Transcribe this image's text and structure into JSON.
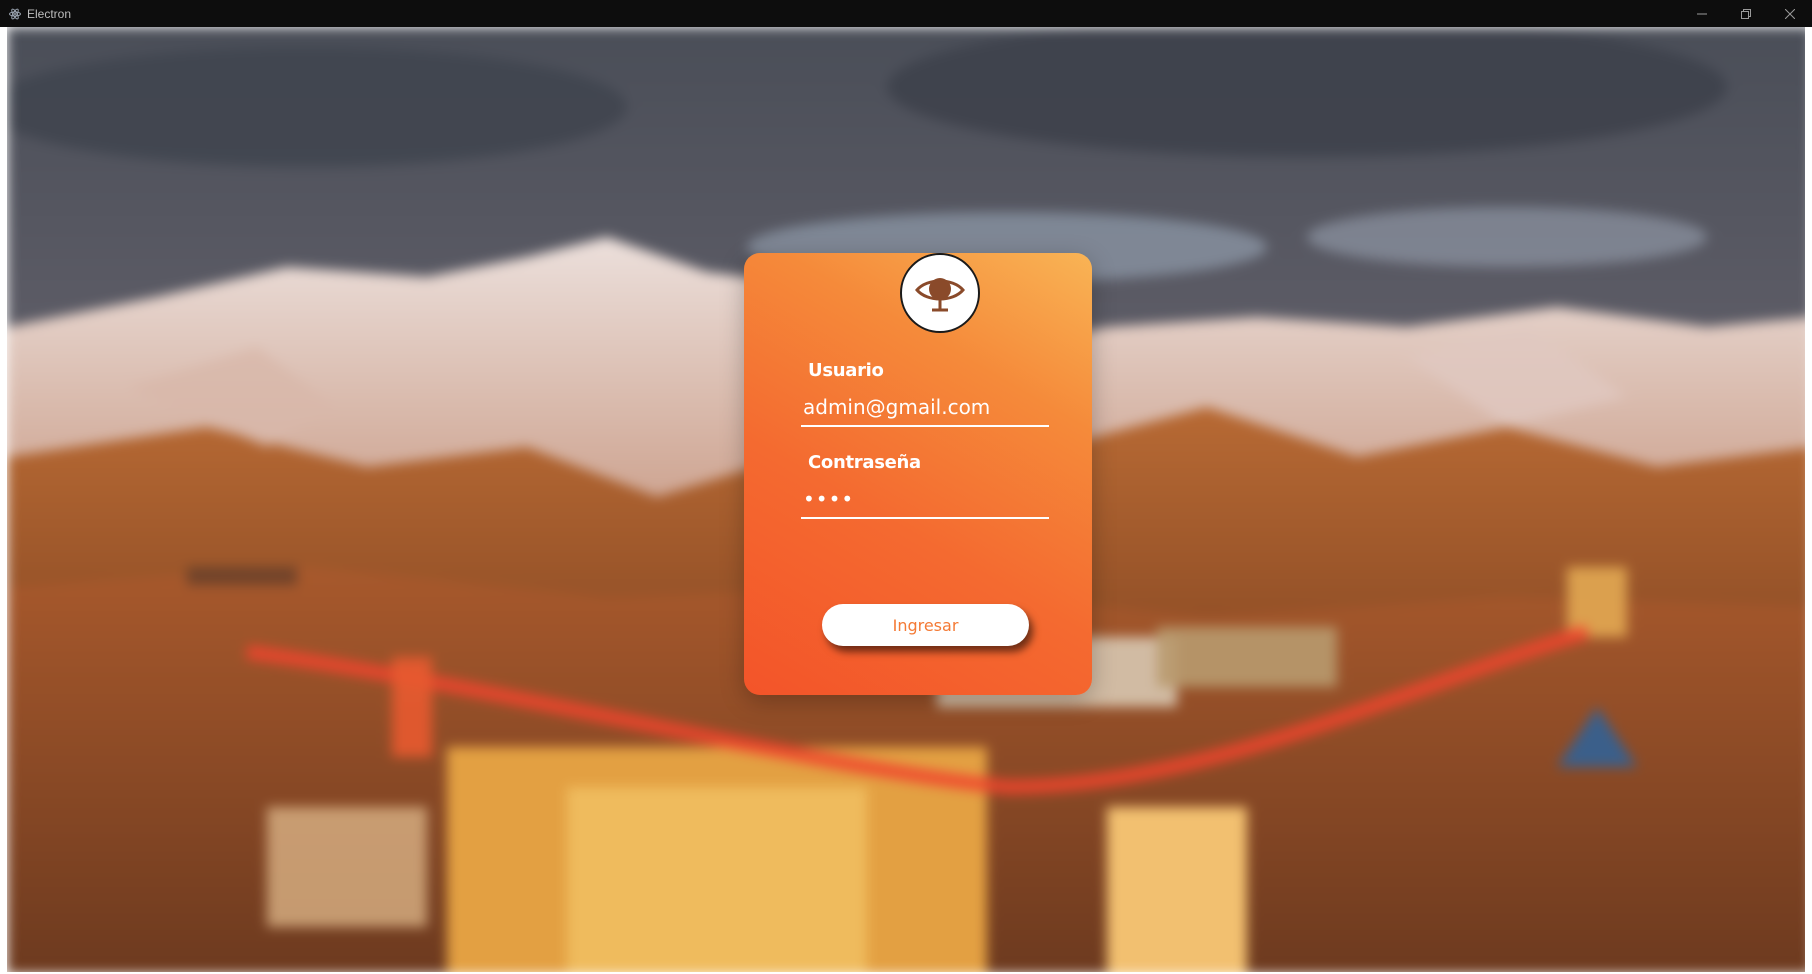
{
  "window": {
    "title": "Electron",
    "icon": "electron-atom-icon",
    "controls": [
      "minimize-icon",
      "restore-icon",
      "close-icon"
    ]
  },
  "background": {
    "description_icon": "mountain-mine-photo",
    "colors": {
      "sky": "#5c5a62",
      "snow": "#e8d9d3",
      "slopes": "#b8642f",
      "conveyor": "#f0452e"
    }
  },
  "login": {
    "logo_icon": "eye-globe-logo-icon",
    "username_label": "Usuario",
    "username_value": "admin@gmail.com",
    "password_label": "Contraseña",
    "password_value": "••••",
    "submit_label": "Ingresar",
    "colors": {
      "gradient_top": "#f9b455",
      "gradient_bottom": "#f35429",
      "button_text": "#f47a35"
    }
  }
}
